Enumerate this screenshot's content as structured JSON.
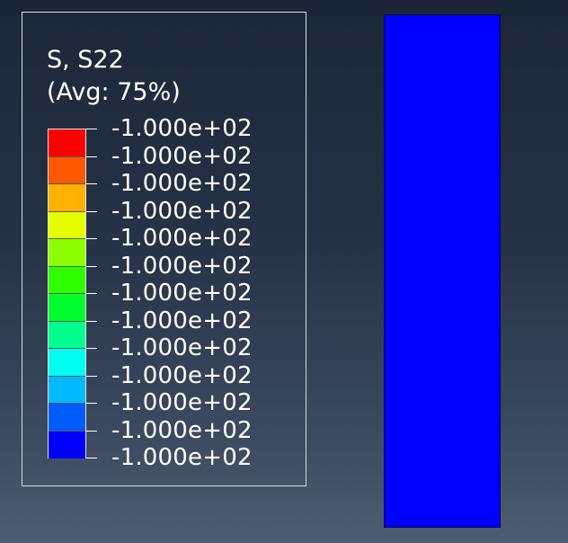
{
  "legend": {
    "title": "S, S22",
    "subtitle": "(Avg: 75%)",
    "band_colors": [
      "#ff0000",
      "#ff5800",
      "#ffb000",
      "#e6ff00",
      "#8eff00",
      "#2eff00",
      "#00ff2e",
      "#00ff8e",
      "#00fff0",
      "#00baff",
      "#005cff",
      "#0000ff"
    ],
    "tick_labels": [
      "-1.000e+02",
      "-1.000e+02",
      "-1.000e+02",
      "-1.000e+02",
      "-1.000e+02",
      "-1.000e+02",
      "-1.000e+02",
      "-1.000e+02",
      "-1.000e+02",
      "-1.000e+02",
      "-1.000e+02",
      "-1.000e+02",
      "-1.000e+02"
    ]
  },
  "viewport": {
    "part_color": "#0000ff"
  }
}
